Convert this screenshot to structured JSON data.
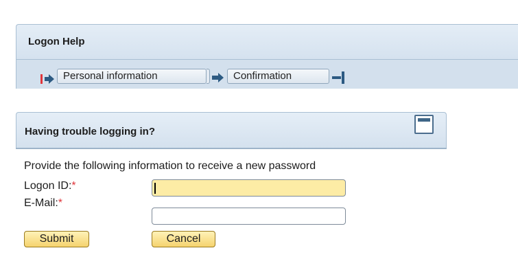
{
  "header": {
    "title": "Logon Help"
  },
  "roadmap": {
    "steps": [
      {
        "label": "Personal information"
      },
      {
        "label": "Confirmation"
      }
    ]
  },
  "panel": {
    "title": "Having trouble logging in?",
    "intro": "Provide the following information to receive a new password",
    "fields": {
      "logon_id": {
        "label": "Logon ID:",
        "required_mark": "*",
        "value": "",
        "focused": true
      },
      "email": {
        "label": "E-Mail:",
        "required_mark": "*",
        "value": ""
      }
    },
    "buttons": {
      "submit": "Submit",
      "cancel": "Cancel"
    }
  },
  "colors": {
    "required": "#e0353b",
    "focused_input": "#fdeca5",
    "button": "#f5d36e",
    "panel_header": "#d4e1ee"
  }
}
